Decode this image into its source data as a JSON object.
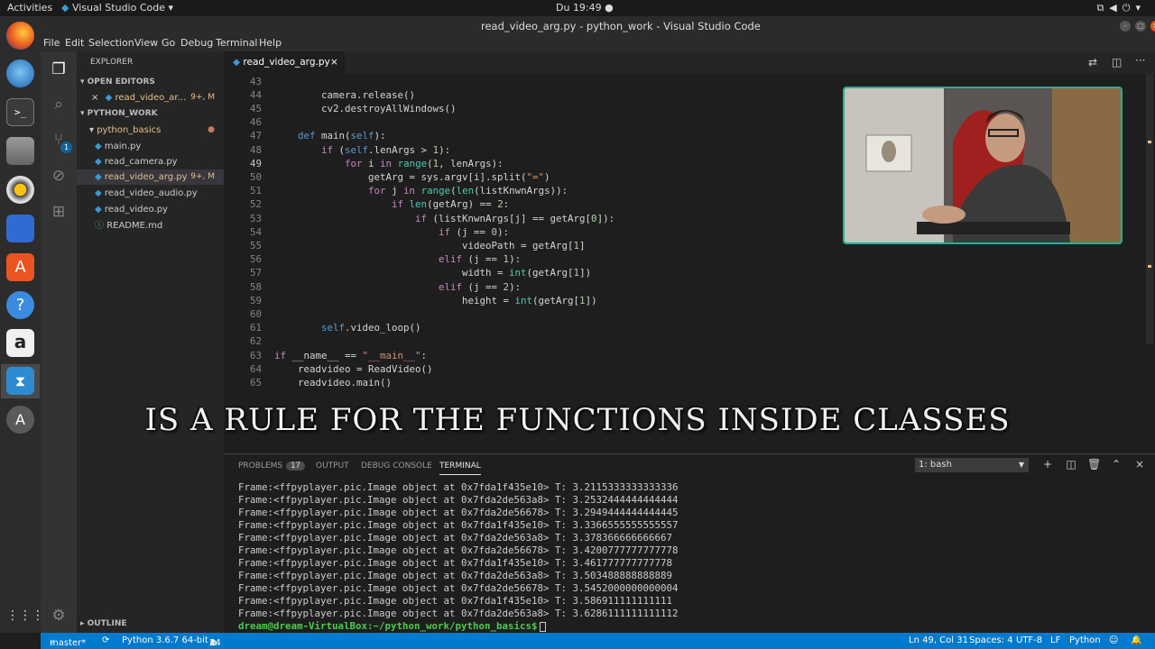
{
  "top_bar": {
    "activities": "Activities",
    "app": "Visual Studio Code",
    "clock": "Du 19:49 ●"
  },
  "window": {
    "title": "read_video_arg.py - python_work - Visual Studio Code"
  },
  "menu": [
    "File",
    "Edit",
    "Selection",
    "View",
    "Go",
    "Debug",
    "Terminal",
    "Help"
  ],
  "explorer": {
    "title": "EXPLORER",
    "open_editors": "OPEN EDITORS",
    "open_file": "read_video_ar...",
    "open_file_status": "9+, M",
    "folder": "PYTHON_WORK",
    "subfolder": "python_basics",
    "files": [
      {
        "name": "main.py",
        "status": ""
      },
      {
        "name": "read_camera.py",
        "status": ""
      },
      {
        "name": "read_video_arg.py",
        "status": "9+, M"
      },
      {
        "name": "read_video_audio.py",
        "status": ""
      },
      {
        "name": "read_video.py",
        "status": ""
      },
      {
        "name": "README.md",
        "status": ""
      }
    ],
    "outline": "OUTLINE"
  },
  "activity_badge": "1",
  "tab": {
    "label": "read_video_arg.py",
    "close": "×"
  },
  "editor": {
    "lines": [
      {
        "n": "43",
        "t": ""
      },
      {
        "n": "44",
        "t": "        camera.release()"
      },
      {
        "n": "45",
        "t": "        cv2.destroyAllWindows()"
      },
      {
        "n": "46",
        "t": ""
      },
      {
        "n": "47",
        "t": "    def main(self):"
      },
      {
        "n": "48",
        "t": "        if (self.lenArgs > 1):"
      },
      {
        "n": "49",
        "t": "            for i in range(1, lenArgs):"
      },
      {
        "n": "50",
        "t": "                getArg = sys.argv[i].split(\"=\")"
      },
      {
        "n": "51",
        "t": "                for j in range(len(listKnwnArgs)):"
      },
      {
        "n": "52",
        "t": "                    if len(getArg) == 2:"
      },
      {
        "n": "53",
        "t": "                        if (listKnwnArgs[j] == getArg[0]):"
      },
      {
        "n": "54",
        "t": "                            if (j == 0):"
      },
      {
        "n": "55",
        "t": "                                videoPath = getArg[1]"
      },
      {
        "n": "56",
        "t": "                            elif (j == 1):"
      },
      {
        "n": "57",
        "t": "                                width = int(getArg[1])"
      },
      {
        "n": "58",
        "t": "                            elif (j == 2):"
      },
      {
        "n": "59",
        "t": "                                height = int(getArg[1])"
      },
      {
        "n": "60",
        "t": ""
      },
      {
        "n": "61",
        "t": "        self.video_loop()"
      },
      {
        "n": "62",
        "t": ""
      },
      {
        "n": "63",
        "t": "if __name__ == \"__main__\":"
      },
      {
        "n": "64",
        "t": "    readvideo = ReadVideo()"
      },
      {
        "n": "65",
        "t": "    readvideo.main()"
      }
    ],
    "current_line": "49"
  },
  "caption": "IS A RULE FOR THE FUNCTIONS INSIDE CLASSES",
  "panel": {
    "tabs": [
      "PROBLEMS",
      "OUTPUT",
      "DEBUG CONSOLE",
      "TERMINAL"
    ],
    "problems_count": "17",
    "terminal_select": "1: bash",
    "terminal_lines": [
      "Frame:<ffpyplayer.pic.Image object at 0x7fda1f435e10> T: 3.2115333333333336",
      "Frame:<ffpyplayer.pic.Image object at 0x7fda2de563a8> T: 3.2532444444444444",
      "Frame:<ffpyplayer.pic.Image object at 0x7fda2de56678> T: 3.2949444444444445",
      "Frame:<ffpyplayer.pic.Image object at 0x7fda1f435e10> T: 3.3366555555555557",
      "Frame:<ffpyplayer.pic.Image object at 0x7fda2de563a8> T: 3.378366666666667",
      "Frame:<ffpyplayer.pic.Image object at 0x7fda2de56678> T: 3.4200777777777778",
      "Frame:<ffpyplayer.pic.Image object at 0x7fda1f435e10> T: 3.461777777777778",
      "Frame:<ffpyplayer.pic.Image object at 0x7fda2de563a8> T: 3.503488888888889",
      "Frame:<ffpyplayer.pic.Image object at 0x7fda2de56678> T: 3.5452000000000004",
      "Frame:<ffpyplayer.pic.Image object at 0x7fda1f435e10> T: 3.586911111111111",
      "Frame:<ffpyplayer.pic.Image object at 0x7fda2de563a8> T: 3.6286111111111112"
    ],
    "prompt": "dream@dream-VirtualBox:~/python_work/python_basics$"
  },
  "status": {
    "branch": "master*",
    "python": "Python 3.6.7 64-bit",
    "errors": "14",
    "warnings": "3",
    "position": "Ln 49, Col 31",
    "spaces": "Spaces: 4",
    "encoding": "UTF-8",
    "eol": "LF",
    "language": "Python"
  },
  "colors": {
    "accent": "#007acc",
    "modified": "#e2c08d",
    "webcam_border": "#1fb19e"
  }
}
